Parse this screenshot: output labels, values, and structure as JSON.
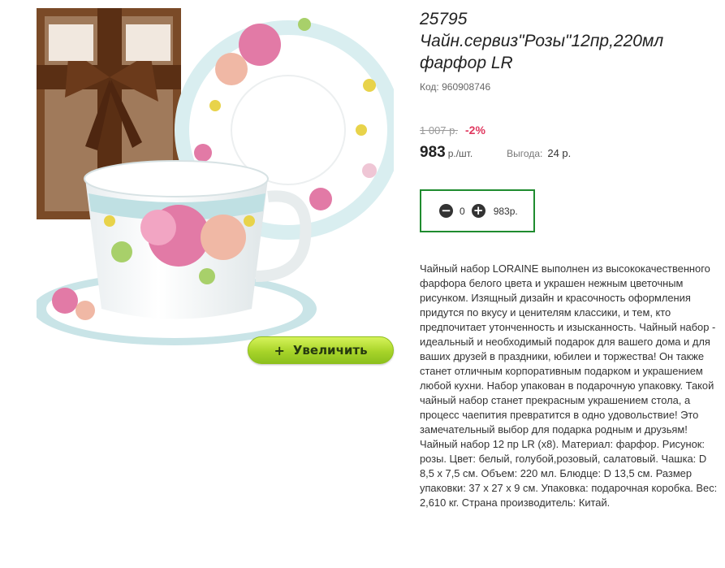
{
  "product": {
    "article": "25795",
    "title_line1": "Чайн.сервиз\"Розы\"12пр,220мл",
    "title_line2": "фарфор LR",
    "code_label": "Код:",
    "code_value": "960908746",
    "old_price": "1 007 р.",
    "discount": "-2%",
    "price": "983",
    "price_unit": "р./шт.",
    "savings_label": "Выгода:",
    "savings_value": "24 р."
  },
  "cart": {
    "minus_icon": "minus-circle-icon",
    "plus_icon": "plus-circle-icon",
    "quantity": "0",
    "total": "983р."
  },
  "image": {
    "zoom_plus": "+",
    "zoom_label": "Увеличить"
  },
  "description": "Чайный набор LORAINE выполнен из высококачественного фарфора белого цвета и украшен нежным цветочным рисунком. Изящный дизайн и красочность оформления придутся по вкусу и ценителям классики, и тем, кто предпочитает утонченность и изысканность. Чайный набор - идеальный и необходимый подарок для вашего дома и для ваших друзей в праздники, юбилеи и торжества! Он также станет отличным корпоративным подарком и украшением любой кухни. Набор упакован в подарочную упаковку. Такой чайный набор станет прекрасным украшением стола, а процесс чаепития превратится в одно удовольствие! Это замечательный выбор для подарка родным и друзьям! Чайный набор 12 пр LR (x8). Материал: фарфор. Рисунок: розы. Цвет: белый, голубой,розовый, салатовый. Чашка: D 8,5 x 7,5 см. Объем: 220 мл. Блюдце: D 13,5 см. Размер упаковки: 37 x 27 x 9 см. Упаковка: подарочная коробка. Вес: 2,610 кг. Страна производитель: Китай.",
  "colors": {
    "accent_green": "#1f8c2f",
    "discount_red": "#e0385f",
    "button_lime": "#a8d429"
  }
}
